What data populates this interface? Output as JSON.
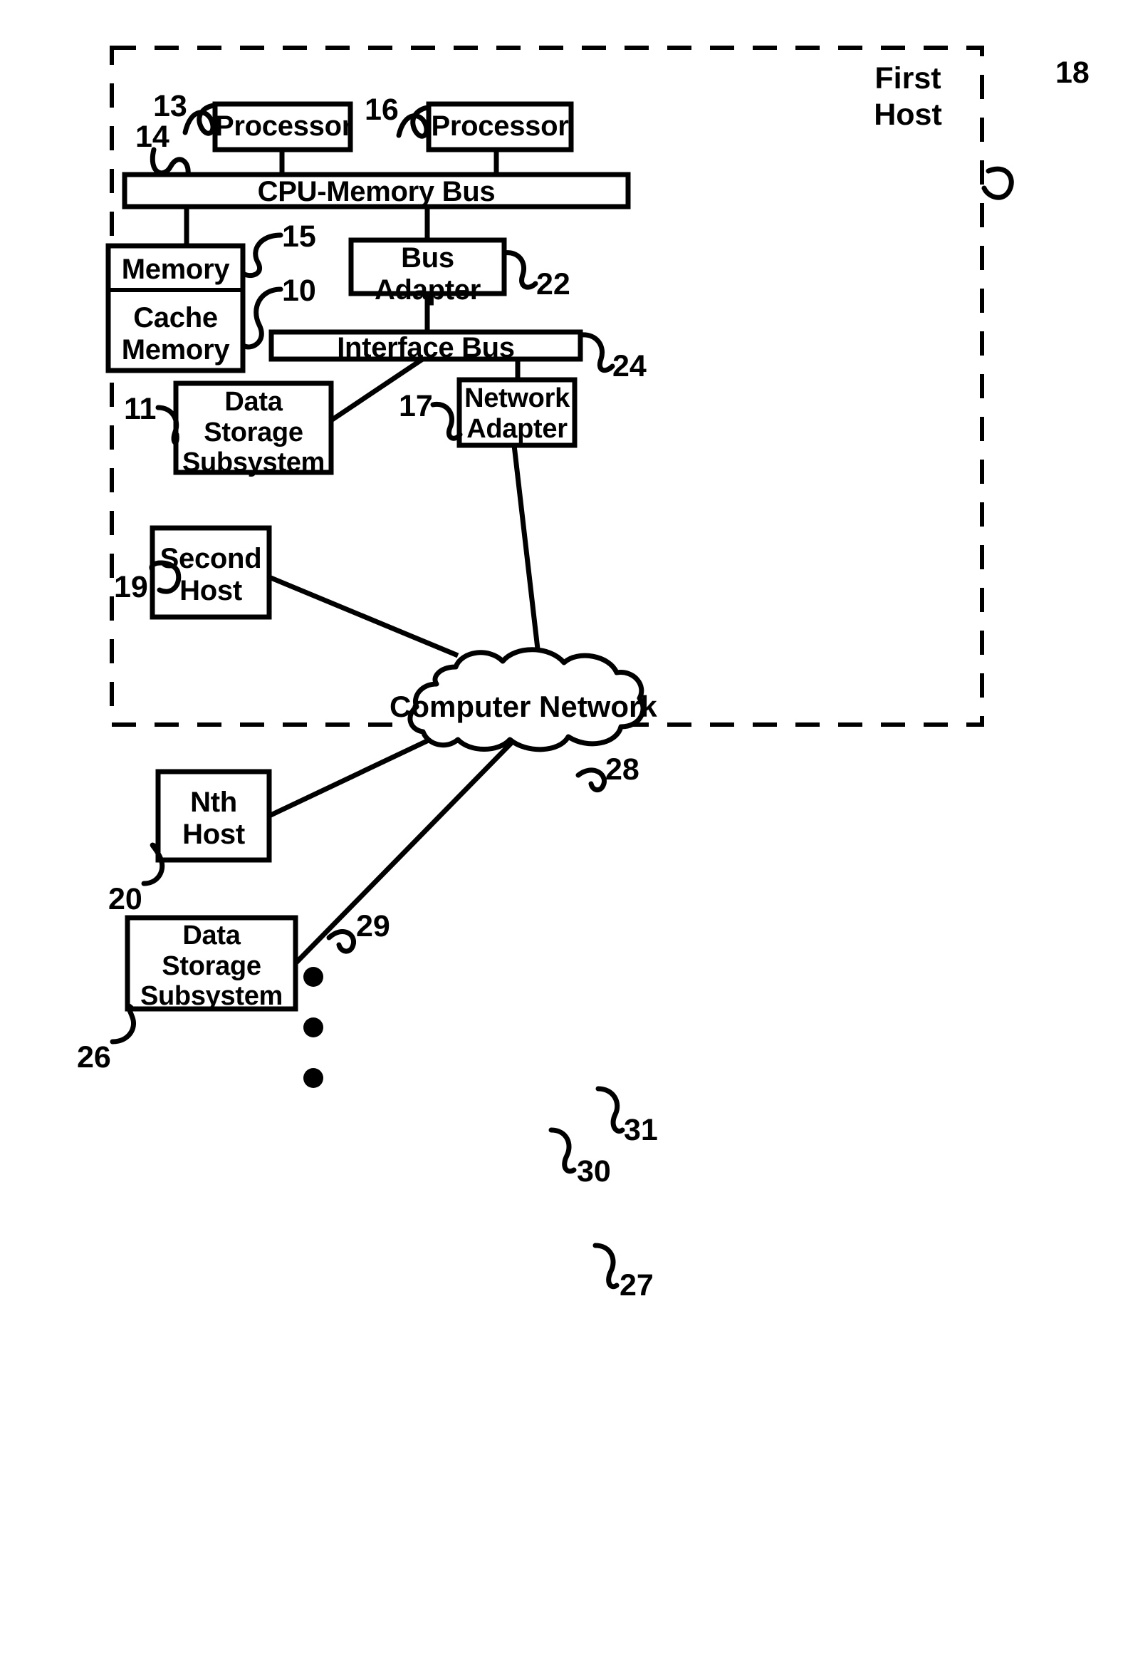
{
  "figure": {
    "type": "patent-block-diagram",
    "background_color": "#ffffff",
    "line_color": "#000000"
  },
  "enclosure": {
    "name": "first-host-boundary",
    "style": "dashed",
    "caption": "First\nHost",
    "reference": "18"
  },
  "blocks": [
    {
      "id": "processor-1",
      "label": "Processor",
      "reference": "13"
    },
    {
      "id": "processor-2",
      "label": "Processor",
      "reference": "16"
    },
    {
      "id": "cpu-memory-bus",
      "label": "CPU-Memory Bus",
      "reference": "14"
    },
    {
      "id": "memory",
      "label": "Memory",
      "reference": "15"
    },
    {
      "id": "cache-memory",
      "label": "Cache\nMemory",
      "reference": "10"
    },
    {
      "id": "bus-adapter",
      "label": "Bus\nAdapter",
      "reference": "22"
    },
    {
      "id": "interface-bus",
      "label": "Interface Bus",
      "reference": "24"
    },
    {
      "id": "data-storage-subsystem",
      "label": "Data\nStorage\nSubsystem",
      "reference": "11"
    },
    {
      "id": "network-adapter",
      "label": "Network\nAdapter",
      "reference": "17"
    },
    {
      "id": "second-host",
      "label": "Second\nHost",
      "reference": "19"
    },
    {
      "id": "nth-host",
      "label": "Nth\nHost",
      "reference": "20"
    },
    {
      "id": "data-storage-subsystem-remote",
      "label": "Data\nStorage\nSubsystem",
      "reference": "26"
    },
    {
      "id": "computer-network",
      "label": "Computer Network",
      "reference": "31"
    }
  ],
  "links": [
    {
      "id": "network-adapter-to-network",
      "reference": "28"
    },
    {
      "id": "second-host-to-network",
      "reference": "29"
    },
    {
      "id": "nth-host-to-network",
      "reference": "30"
    },
    {
      "id": "storage-to-network",
      "reference": "27"
    }
  ],
  "ellipsis": {
    "id": "host-ellipsis",
    "dots": 3
  },
  "text": {
    "processor_1": "Processor",
    "processor_2": "Processor",
    "cpu_memory_bus": "CPU-Memory Bus",
    "memory": "Memory",
    "cache_memory": "Cache\nMemory",
    "bus_adapter": "Bus\nAdapter",
    "interface_bus": "Interface Bus",
    "data_storage_subsystem": "Data\nStorage\nSubsystem",
    "network_adapter": "Network\nAdapter",
    "second_host": "Second\nHost",
    "nth_host": "Nth\nHost",
    "data_storage_subsystem_remote": "Data\nStorage\nSubsystem",
    "computer_network": "Computer Network",
    "first_host_caption": "First\nHost"
  },
  "refs": {
    "r10": "10",
    "r11": "11",
    "r13": "13",
    "r14": "14",
    "r15": "15",
    "r16": "16",
    "r17": "17",
    "r18": "18",
    "r19": "19",
    "r20": "20",
    "r22": "22",
    "r24": "24",
    "r26": "26",
    "r27": "27",
    "r28": "28",
    "r29": "29",
    "r30": "30",
    "r31": "31"
  }
}
